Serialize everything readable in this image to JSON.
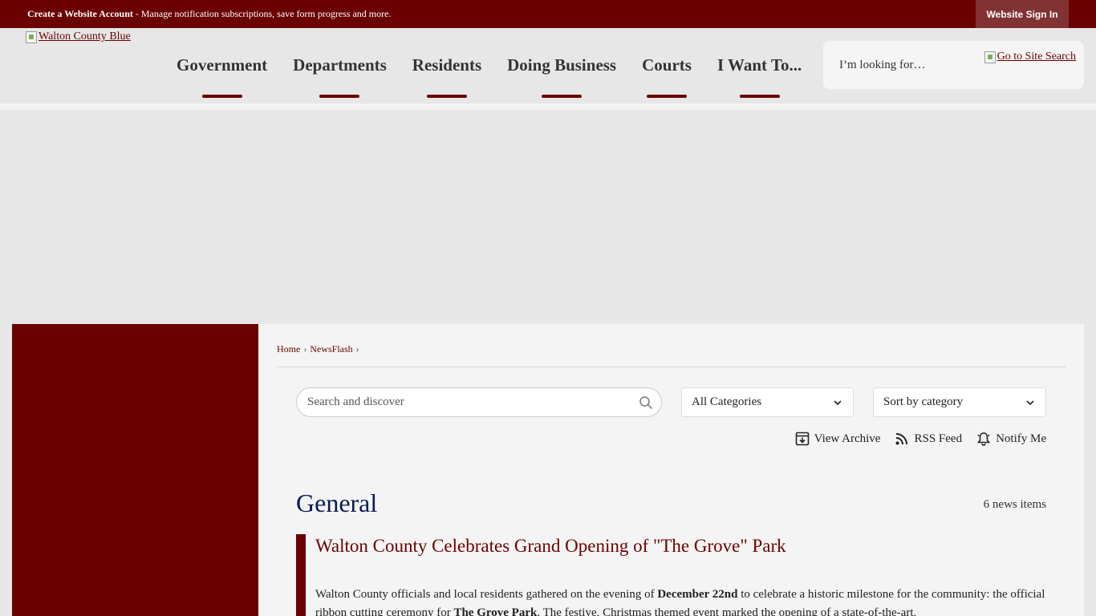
{
  "topbar": {
    "create_account": "Create a Website Account",
    "message": " - Manage notification subscriptions, save form progress and more.",
    "sign_in": "Website Sign In"
  },
  "header": {
    "logo_alt": "Walton County Blue",
    "nav": [
      "Government",
      "Departments",
      "Residents",
      "Doing Business",
      "Courts",
      "I Want To..."
    ],
    "search_placeholder": "I’m looking for…",
    "search_button_alt": "Go to Site Search"
  },
  "breadcrumb": [
    "Home",
    "NewsFlash"
  ],
  "news_search": {
    "placeholder": "Search and discover"
  },
  "filters": {
    "category": "All Categories",
    "sort": "Sort by category"
  },
  "actions": {
    "archive": "View Archive",
    "rss": "RSS Feed",
    "notify": "Notify Me"
  },
  "section": {
    "title": "General",
    "count": "6 news items"
  },
  "article": {
    "title": "Walton County Celebrates Grand Opening of \"The Grove\" Park",
    "p_part1": "Walton County officials and local residents gathered on the evening of ",
    "p_bold1": "December 22nd",
    "p_part2": " to celebrate a historic milestone for the community: the official ribbon cutting ceremony for ",
    "p_bold2": "The Grove Park",
    "p_part3": ". The festive, Christmas themed event marked the opening of a state-of-the-art,"
  },
  "colors": {
    "brand": "#6b0000",
    "title": "#0a1a52"
  }
}
